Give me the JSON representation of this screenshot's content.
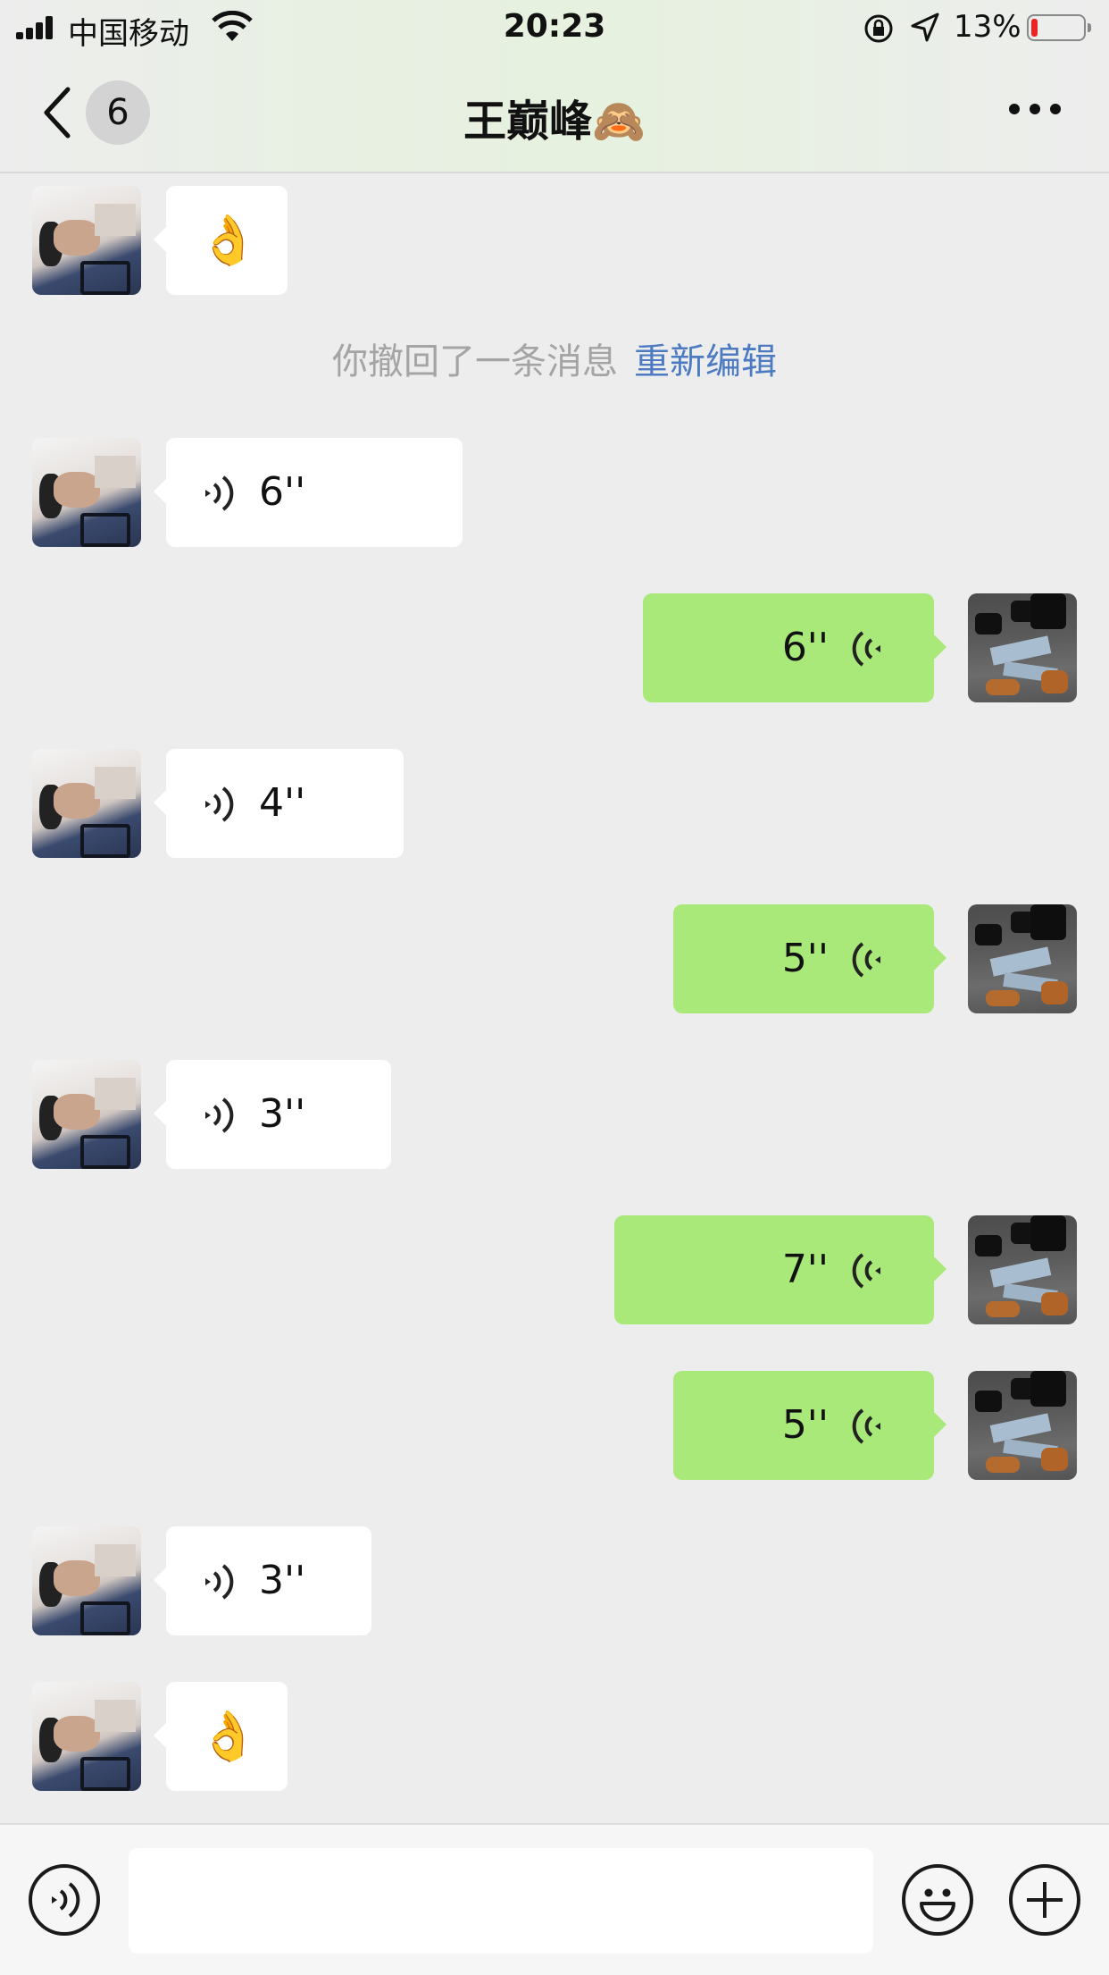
{
  "status": {
    "carrier": "中国移动",
    "time": "20:23",
    "battery": "13%",
    "battery_level": 0.13
  },
  "nav": {
    "unread_count": "6",
    "title": "王巅峰",
    "title_emoji": "🙈"
  },
  "recall": {
    "text": "你撤回了一条消息",
    "action": "重新编辑"
  },
  "messages": [
    {
      "from": "them",
      "type": "emoji",
      "content": "👌"
    },
    {
      "from": "them",
      "type": "voice",
      "duration": "6''"
    },
    {
      "from": "me",
      "type": "voice",
      "duration": "6''"
    },
    {
      "from": "them",
      "type": "voice",
      "duration": "4''"
    },
    {
      "from": "me",
      "type": "voice",
      "duration": "5''"
    },
    {
      "from": "them",
      "type": "voice",
      "duration": "3''"
    },
    {
      "from": "me",
      "type": "voice",
      "duration": "7''"
    },
    {
      "from": "me",
      "type": "voice",
      "duration": "5''"
    },
    {
      "from": "them",
      "type": "voice",
      "duration": "3''"
    },
    {
      "from": "them",
      "type": "emoji",
      "content": "👌"
    }
  ],
  "input": {
    "value": "",
    "placeholder": ""
  },
  "icons": {
    "back": "chevron-left-icon",
    "more": "more-dots-icon",
    "voice_mode": "voice-mode-icon",
    "emoji": "emoji-face-icon",
    "plus": "plus-icon"
  },
  "colors": {
    "outgoing_bubble": "#a9e97a",
    "incoming_bubble": "#ffffff",
    "link": "#4c7bc2",
    "background": "#ededed"
  }
}
